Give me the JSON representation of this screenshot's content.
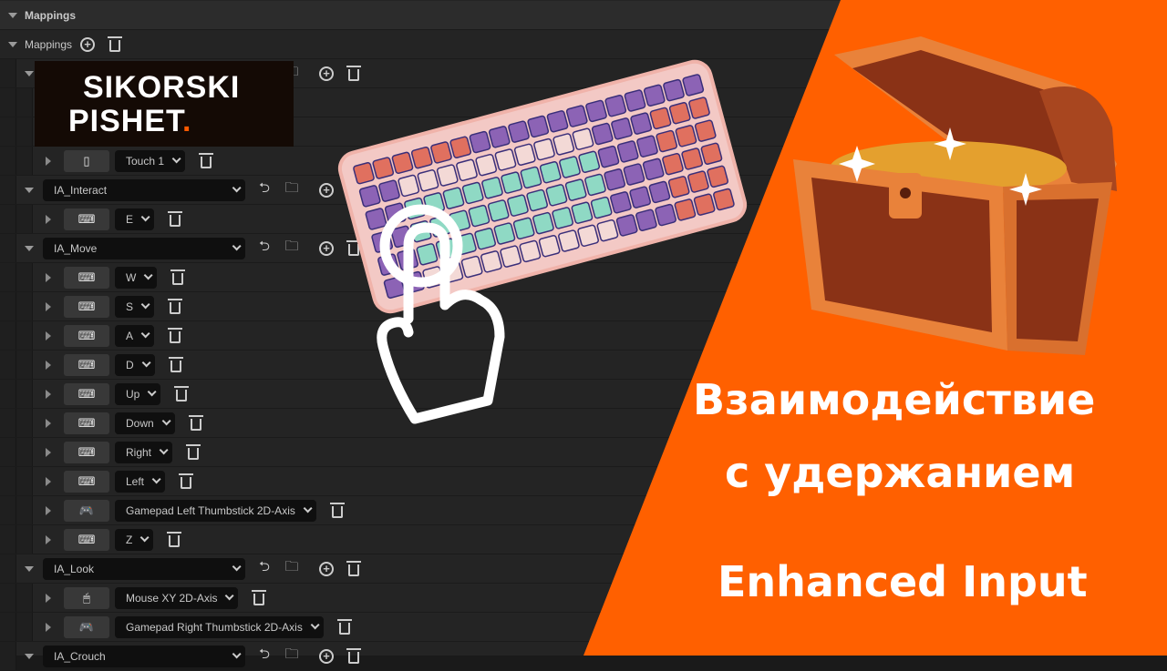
{
  "header": {
    "title": "Mappings"
  },
  "mappings": {
    "label": "Mappings"
  },
  "rows": [
    {
      "type": "action",
      "label": ""
    },
    {
      "type": "hidden"
    },
    {
      "type": "key",
      "icon": "keyboard-icon",
      "label": ""
    },
    {
      "type": "key",
      "icon": "touch-icon",
      "label": "Touch 1"
    },
    {
      "type": "action",
      "label": "IA_Interact"
    },
    {
      "type": "key",
      "icon": "keyboard-icon",
      "label": "E"
    },
    {
      "type": "action",
      "label": "IA_Move"
    },
    {
      "type": "key",
      "icon": "keyboard-icon",
      "label": "W"
    },
    {
      "type": "key",
      "icon": "keyboard-icon",
      "label": "S"
    },
    {
      "type": "key",
      "icon": "keyboard-icon",
      "label": "A"
    },
    {
      "type": "key",
      "icon": "keyboard-icon",
      "label": "D"
    },
    {
      "type": "key",
      "icon": "keyboard-icon",
      "label": "Up"
    },
    {
      "type": "key",
      "icon": "keyboard-icon",
      "label": "Down"
    },
    {
      "type": "key",
      "icon": "keyboard-icon",
      "label": "Right"
    },
    {
      "type": "key",
      "icon": "keyboard-icon",
      "label": "Left"
    },
    {
      "type": "key",
      "icon": "gamepad-icon",
      "label": "Gamepad Left Thumbstick 2D-Axis"
    },
    {
      "type": "key",
      "icon": "keyboard-icon",
      "label": "Z"
    },
    {
      "type": "action",
      "label": "IA_Look"
    },
    {
      "type": "key",
      "icon": "mouse-icon",
      "label": "Mouse XY 2D-Axis"
    },
    {
      "type": "key",
      "icon": "gamepad-icon",
      "label": "Gamepad Right Thumbstick 2D-Axis"
    },
    {
      "type": "action",
      "label": "IA_Crouch"
    }
  ],
  "logo": {
    "line1": "SIKORSKI",
    "line2": "PISHET",
    "dot": "."
  },
  "promo": {
    "title_line1": "Взаимодействие",
    "title_line2": "с удержанием",
    "subtitle": "Enhanced Input"
  },
  "colors": {
    "accent": "#FF6000",
    "panel": "#242424"
  }
}
